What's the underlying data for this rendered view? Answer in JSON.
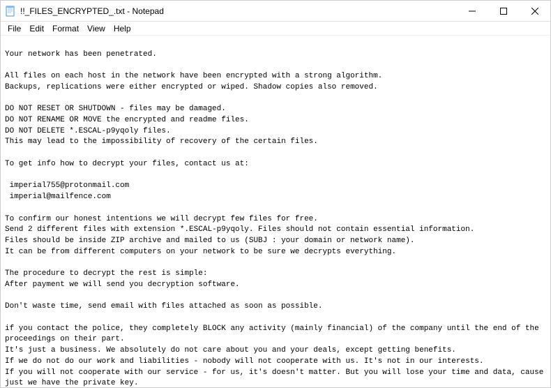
{
  "window": {
    "title": "!!_FILES_ENCRYPTED_.txt - Notepad"
  },
  "menubar": {
    "items": [
      {
        "label": "File"
      },
      {
        "label": "Edit"
      },
      {
        "label": "Format"
      },
      {
        "label": "View"
      },
      {
        "label": "Help"
      }
    ]
  },
  "content": "\nYour network has been penetrated.\n\nAll files on each host in the network have been encrypted with a strong algorithm.\nBackups, replications were either encrypted or wiped. Shadow copies also removed.\n\nDO NOT RESET OR SHUTDOWN - files may be damaged.\nDO NOT RENAME OR MOVE the encrypted and readme files.\nDO NOT DELETE *.ESCAL-p9yqoly files.\nThis may lead to the impossibility of recovery of the certain files.\n\nTo get info how to decrypt your files, contact us at:\n\n imperial755@protonmail.com\n imperial@mailfence.com\n\nTo confirm our honest intentions we will decrypt few files for free.\nSend 2 different files with extension *.ESCAL-p9yqoly. Files should not contain essential information.\nFiles should be inside ZIP archive and mailed to us (SUBJ : your domain or network name).\nIt can be from different computers on your network to be sure we decrypts everything.\n\nThe procedure to decrypt the rest is simple:\nAfter payment we will send you decryption software.\n\nDon't waste time, send email with files attached as soon as possible.\n\nif you contact the police, they completely BLOCK any activity (mainly financial) of the company until the end of the proceedings on their part.\nIt's just a business. We absolutely do not care about you and your deals, except getting benefits.\nIf we do not do our work and liabilities - nobody will not cooperate with us. It's not in our interests.\nIf you will not cooperate with our service - for us, it's doesn't matter. But you will lose your time and data, cause just we have the private key."
}
